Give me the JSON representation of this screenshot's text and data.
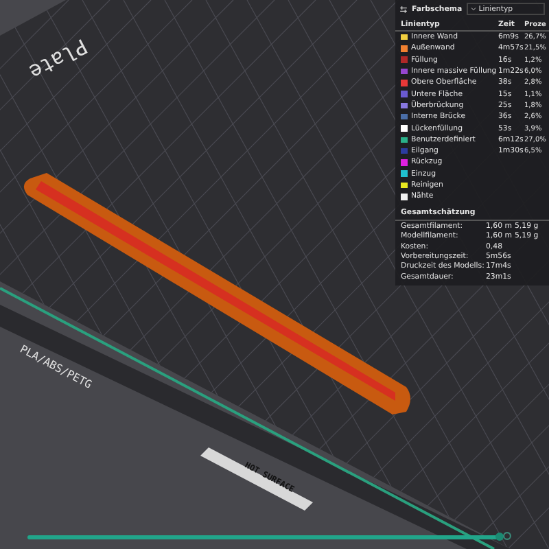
{
  "legend": {
    "title": "Farbschema",
    "scheme": "Linientyp",
    "columns": [
      "Linientyp",
      "Zeit",
      "Proze"
    ],
    "rows": [
      {
        "name": "Innere Wand",
        "time": "6m9s",
        "percent": "26,7%",
        "color": "#f2d040"
      },
      {
        "name": "Außenwand",
        "time": "4m57s",
        "percent": "21,5%",
        "color": "#f08030"
      },
      {
        "name": "Füllung",
        "time": "16s",
        "percent": "1,2%",
        "color": "#b02828"
      },
      {
        "name": "Innere massive Füllung",
        "time": "1m22s",
        "percent": "6,0%",
        "color": "#9646d0"
      },
      {
        "name": "Obere Oberfläche",
        "time": "38s",
        "percent": "2,8%",
        "color": "#e83838"
      },
      {
        "name": "Untere Fläche",
        "time": "15s",
        "percent": "1,1%",
        "color": "#6a5ad0"
      },
      {
        "name": "Überbrückung",
        "time": "25s",
        "percent": "1,8%",
        "color": "#8878e0"
      },
      {
        "name": "Interne Brücke",
        "time": "36s",
        "percent": "2,6%",
        "color": "#4a6ea8"
      },
      {
        "name": "Lückenfüllung",
        "time": "53s",
        "percent": "3,9%",
        "color": "#ffffff"
      },
      {
        "name": "Benutzerdefiniert",
        "time": "6m12s",
        "percent": "27,0%",
        "color": "#2ab08a"
      },
      {
        "name": "Eilgang",
        "time": "1m30s",
        "percent": "6,5%",
        "color": "#2c3ca0"
      },
      {
        "name": "Rückzug",
        "color": "#e020e0"
      },
      {
        "name": "Einzug",
        "color": "#20c0d0"
      },
      {
        "name": "Reinigen",
        "color": "#e8e820"
      },
      {
        "name": "Nähte",
        "color": "#f0f0f0"
      }
    ],
    "estimate": {
      "title": "Gesamtschätzung",
      "rows": [
        {
          "label": "Gesamtfilament:",
          "values": [
            "1,60 m",
            "5,19 g"
          ]
        },
        {
          "label": "Modellfilament:",
          "values": [
            "1,60 m",
            "5,19 g"
          ]
        },
        {
          "label": "Kosten:",
          "values": [
            "0,48"
          ]
        },
        {
          "label": "Vorbereitungszeit:",
          "values": [
            "5m56s"
          ]
        },
        {
          "label": "Druckzeit des Modells:",
          "values": [
            "17m4s"
          ]
        },
        {
          "label": "Gesamtdauer:",
          "values": [
            "23m1s"
          ]
        }
      ]
    }
  },
  "plate": {
    "labels": [
      "Plate",
      "PLA/ABS/PETG",
      "HOT SURFACE"
    ]
  },
  "layer_slider": {
    "level": 1
  }
}
